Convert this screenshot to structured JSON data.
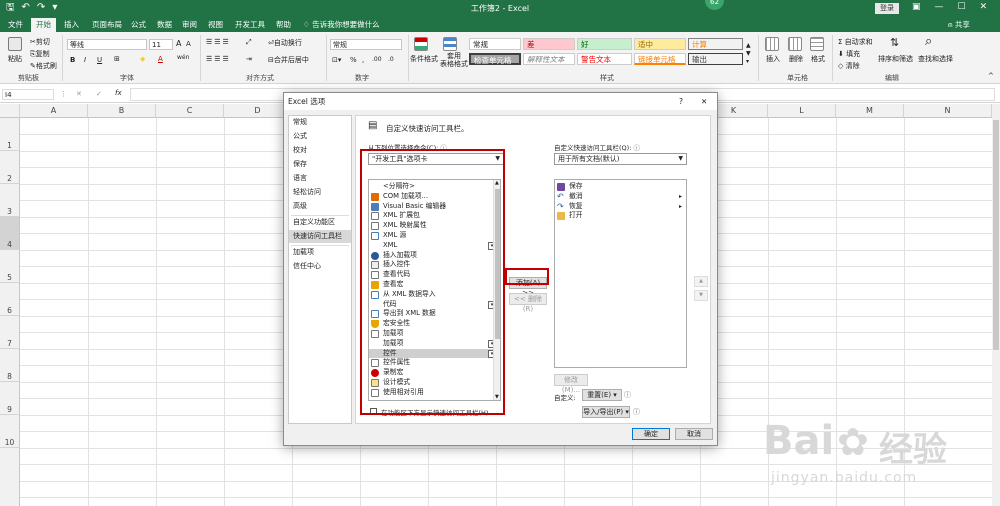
{
  "window": {
    "title": "工作簿2 - Excel",
    "login": "登录",
    "badge": "62",
    "share": "共享"
  },
  "qat": {
    "save": "🖫",
    "undo": "↶",
    "redo": "↷",
    "more": "▾"
  },
  "tabs": [
    "文件",
    "开始",
    "插入",
    "页面布局",
    "公式",
    "数据",
    "审阅",
    "视图",
    "开发工具",
    "帮助",
    "告诉我你想要做什么"
  ],
  "active_tab": "开始",
  "ribbon": {
    "clipboard": {
      "group": "剪贴板",
      "paste": "粘贴",
      "cut": "剪切",
      "copy": "复制",
      "format_painter": "格式刷"
    },
    "font": {
      "group": "字体",
      "name": "等线",
      "size": "11",
      "bold": "B",
      "italic": "I",
      "underline": "U",
      "grow": "A",
      "shrink": "A",
      "wen": "wén"
    },
    "alignment": {
      "group": "对齐方式",
      "wrap": "自动换行",
      "merge": "合并后居中"
    },
    "number": {
      "group": "数字",
      "format": "常规",
      "percent": "%",
      "comma": ",",
      "inc": ".00",
      "dec": ".0"
    },
    "styles": {
      "group": "样式",
      "conditional": "条件格式",
      "table": "套用\n表格格式",
      "cell_styles": [
        "常规",
        "差",
        "好",
        "适中",
        "计算",
        "检查单元格",
        "解释性文本",
        "警告文本",
        "链接单元格",
        "输出"
      ]
    },
    "cells": {
      "group": "单元格",
      "insert": "插入",
      "delete": "删除",
      "format": "格式"
    },
    "editing": {
      "group": "编辑",
      "autosum": "自动求和",
      "fill": "填充",
      "clear": "清除",
      "sort": "排序和筛选",
      "find": "查找和选择"
    }
  },
  "formula_bar": {
    "namebox": "I4",
    "cancel": "✕",
    "enter": "✓",
    "fx": "fx"
  },
  "grid": {
    "columns": [
      "A",
      "B",
      "C",
      "D",
      "E",
      "F",
      "G",
      "H",
      "I",
      "J",
      "K",
      "L",
      "M",
      "N"
    ],
    "rows": [
      "1",
      "2",
      "3",
      "4",
      "5",
      "6",
      "7",
      "8",
      "9",
      "10"
    ]
  },
  "dialog": {
    "title": "Excel 选项",
    "help": "?",
    "close": "✕",
    "nav": [
      "常规",
      "公式",
      "校对",
      "保存",
      "语言",
      "轻松访问",
      "高级",
      "自定义功能区",
      "快速访问工具栏",
      "加载项",
      "信任中心"
    ],
    "nav_selected": "快速访问工具栏",
    "heading": "自定义快速访问工具栏。",
    "choose_label": "从下列位置选择命令(C):",
    "choose_value": "\"开发工具\"选项卡",
    "commands": [
      "<分隔符>",
      "COM 加载项...",
      "Visual Basic 编辑器",
      "XML 扩展包",
      "XML 映射属性",
      "XML 源",
      "XML",
      "插入加载项",
      "插入控件",
      "查看代码",
      "查看宏",
      "从 XML 数据导入",
      "代码",
      "导出到 XML 数据",
      "宏安全性",
      "加载项",
      "加载项",
      "控件",
      "控件属性",
      "录制宏",
      "设计模式",
      "使用相对引用"
    ],
    "command_selected": "控件",
    "customize_label": "自定义快速访问工具栏(Q):",
    "customize_value": "用于所有文档(默认)",
    "qat_items": [
      "保存",
      "撤消",
      "恢复",
      "打开"
    ],
    "add": "添加(A) >>",
    "remove": "<< 删除(R)",
    "modify": "修改(M)...",
    "customizations_label": "自定义:",
    "reset": "重置(E) ▾",
    "import_export": "导入/导出(P) ▾",
    "show_below": "在功能区下方显示快速访问工具栏(H)",
    "ok": "确定",
    "cancel": "取消"
  },
  "watermark": {
    "brand": "Bai",
    "cn": "经验",
    "url": "jingyan.baidu.com"
  }
}
